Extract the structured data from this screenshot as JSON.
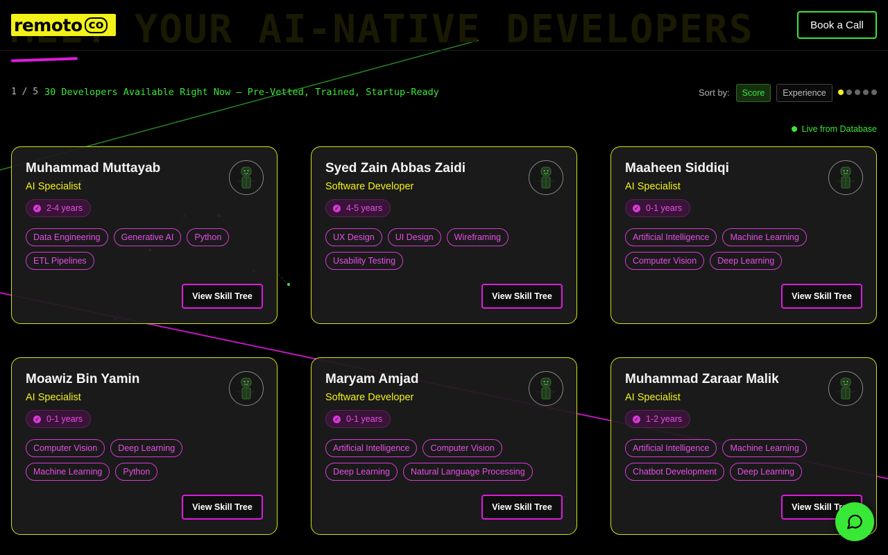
{
  "header": {
    "logo_main": "remoto",
    "logo_co": "co",
    "hero_bg": "MEET YOUR AI-NATIVE DEVELOPERS",
    "book_call": "Book a Call"
  },
  "toolbar": {
    "page_indicator": "1 / 5",
    "available": "30 Developers Available Right Now — Pre-Vetted, Trained, Startup-Ready",
    "sort_label": "Sort by:",
    "sort_score": "Score",
    "sort_experience": "Experience",
    "active_page": 1,
    "total_pages": 5
  },
  "live_label": "Live from Database",
  "skill_button_label": "View Skill Tree",
  "developers": [
    {
      "name": "Muhammad Muttayab",
      "role": "AI Specialist",
      "experience": "2-4 years",
      "skills": [
        "Data Engineering",
        "Generative AI",
        "Python",
        "ETL Pipelines"
      ]
    },
    {
      "name": "Syed Zain Abbas Zaidi",
      "role": "Software Developer",
      "experience": "4-5 years",
      "skills": [
        "UX Design",
        "UI Design",
        "Wireframing",
        "Usability Testing"
      ]
    },
    {
      "name": "Maaheen Siddiqi",
      "role": "AI Specialist",
      "experience": "0-1 years",
      "skills": [
        "Artificial Intelligence",
        "Machine Learning",
        "Computer Vision",
        "Deep Learning"
      ]
    },
    {
      "name": "Moawiz Bin Yamin",
      "role": "AI Specialist",
      "experience": "0-1 years",
      "skills": [
        "Computer Vision",
        "Deep Learning",
        "Machine Learning",
        "Python"
      ]
    },
    {
      "name": "Maryam Amjad",
      "role": "Software Developer",
      "experience": "0-1 years",
      "skills": [
        "Artificial Intelligence",
        "Computer Vision",
        "Deep Learning",
        "Natural Language Processing"
      ]
    },
    {
      "name": "Muhammad Zaraar Malik",
      "role": "AI Specialist",
      "experience": "1-2 years",
      "skills": [
        "Artificial Intelligence",
        "Machine Learning",
        "Chatbot Development",
        "Deep Learning"
      ]
    }
  ],
  "colors": {
    "accent_yellow": "#f2f21a",
    "accent_green": "#39e836",
    "accent_pink": "#e01ae0"
  },
  "icons": {
    "avatar": "developer-avatar-icon",
    "experience": "check-circle-icon",
    "chat": "chat-bubble-icon"
  }
}
